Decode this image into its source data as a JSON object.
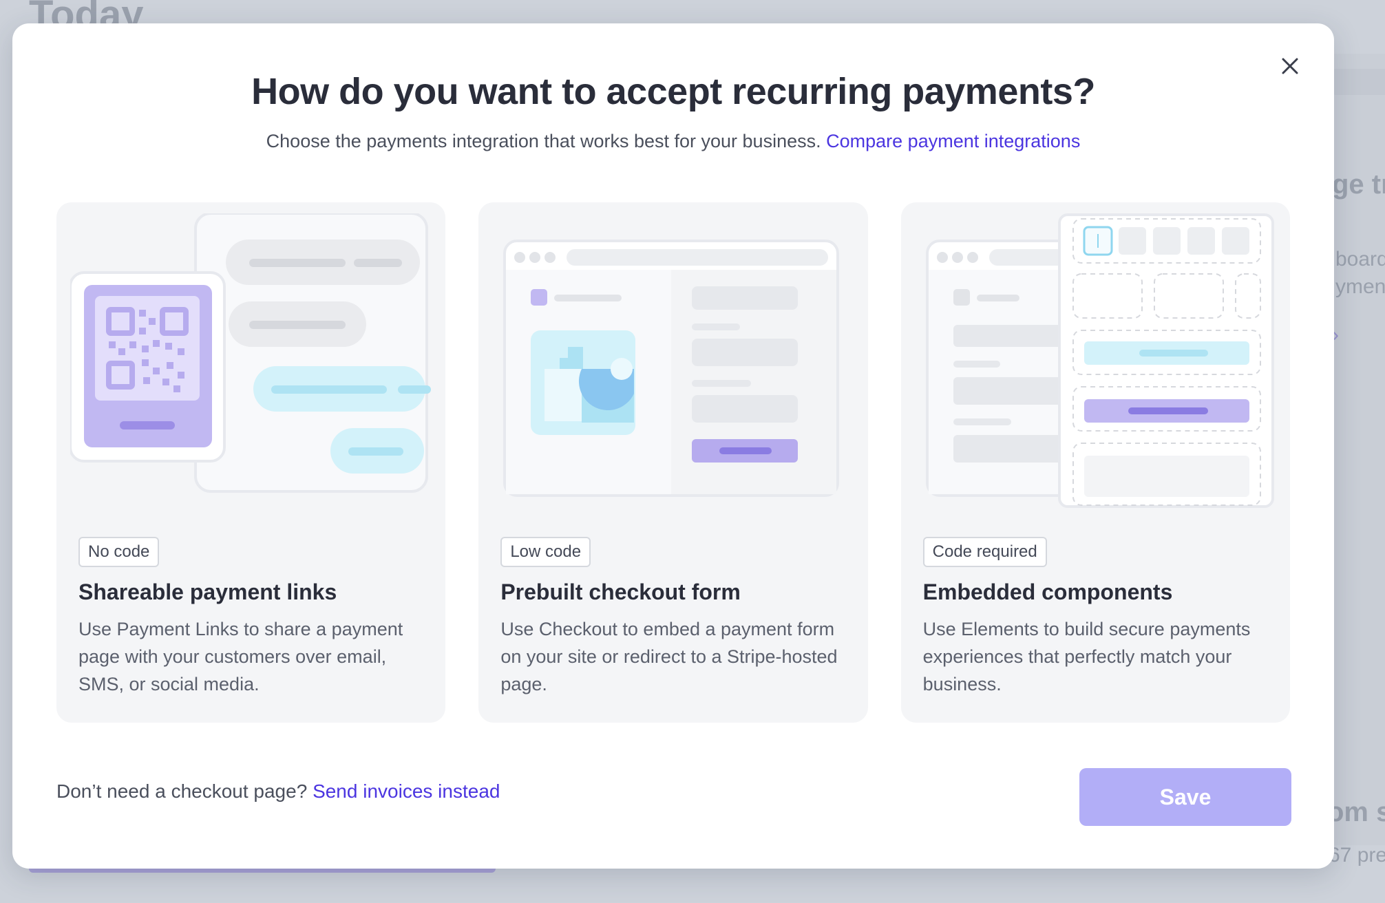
{
  "background": {
    "page_title": "Today",
    "right_snippets": [
      "ge tr",
      "board",
      "ymen",
      "om sa",
      "67 pre"
    ]
  },
  "modal": {
    "title": "How do you want to accept recurring payments?",
    "subtitle": "Choose the payments integration that works best for your business.",
    "subtitle_link": "Compare payment integrations",
    "cards": [
      {
        "tag": "No code",
        "title": "Shareable payment links",
        "description": "Use Payment Links to share a payment page with your customers over email, SMS, or social media."
      },
      {
        "tag": "Low code",
        "title": "Prebuilt checkout form",
        "description": "Use Checkout to embed a payment form on your site or redirect to a Stripe-hosted page."
      },
      {
        "tag": "Code required",
        "title": "Embedded components",
        "description": "Use Elements to build secure payments experiences that perfectly match your business."
      }
    ],
    "footer_text": "Don’t need a checkout page?",
    "footer_link": "Send invoices instead",
    "save_label": "Save"
  },
  "icons": {
    "close": "close-icon"
  },
  "colors": {
    "accent": "#4b35e0",
    "save_button": "#b2aef7",
    "card_bg": "#f4f5f7",
    "illus_purple": "#c1b8f2",
    "illus_cyan": "#d3f2fa"
  }
}
